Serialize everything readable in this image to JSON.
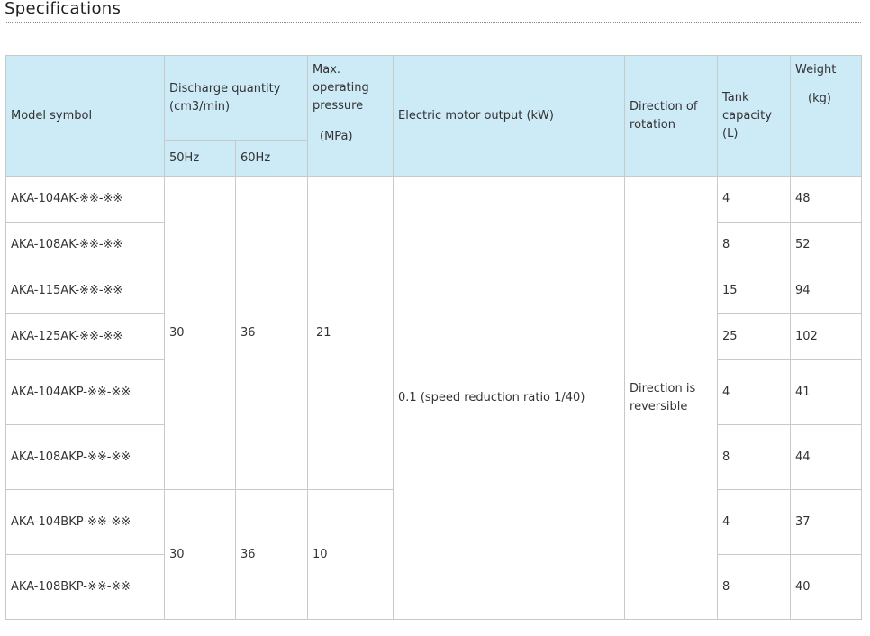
{
  "section": {
    "title": "Specifications"
  },
  "headers": {
    "model_symbol": "Model symbol",
    "discharge": "Discharge quantity (cm3/min)",
    "hz50": "50Hz",
    "hz60": "60Hz",
    "pressure": "Max. operating pressure",
    "pressure_unit": "(MPa)",
    "motor": "Electric motor output  (kW)",
    "rotation": "Direction of rotation",
    "tank": "Tank capacity (L)",
    "weight": "Weight",
    "weight_unit": "(kg)"
  },
  "groups": [
    {
      "hz50": "30",
      "hz60": "36",
      "pressure": "21"
    },
    {
      "hz50": "30",
      "hz60": "36",
      "pressure": "10"
    }
  ],
  "motor_output": "0.1 (speed reduction ratio 1/40)",
  "rotation": "Direction is reversible",
  "rows": [
    {
      "model": "AKA-104AK-※※-※※",
      "tank": "4",
      "weight": "48"
    },
    {
      "model": "AKA-108AK-※※-※※",
      "tank": "8",
      "weight": "52"
    },
    {
      "model": "AKA-115AK-※※-※※",
      "tank": "15",
      "weight": "94"
    },
    {
      "model": "AKA-125AK-※※-※※",
      "tank": "25",
      "weight": "102"
    },
    {
      "model": "AKA-104AKP-※※-※※",
      "tank": "4",
      "weight": "41"
    },
    {
      "model": "AKA-108AKP-※※-※※",
      "tank": "8",
      "weight": "44"
    },
    {
      "model": "AKA-104BKP-※※-※※",
      "tank": "4",
      "weight": "37"
    },
    {
      "model": "AKA-108BKP-※※-※※",
      "tank": "8",
      "weight": "40"
    }
  ]
}
